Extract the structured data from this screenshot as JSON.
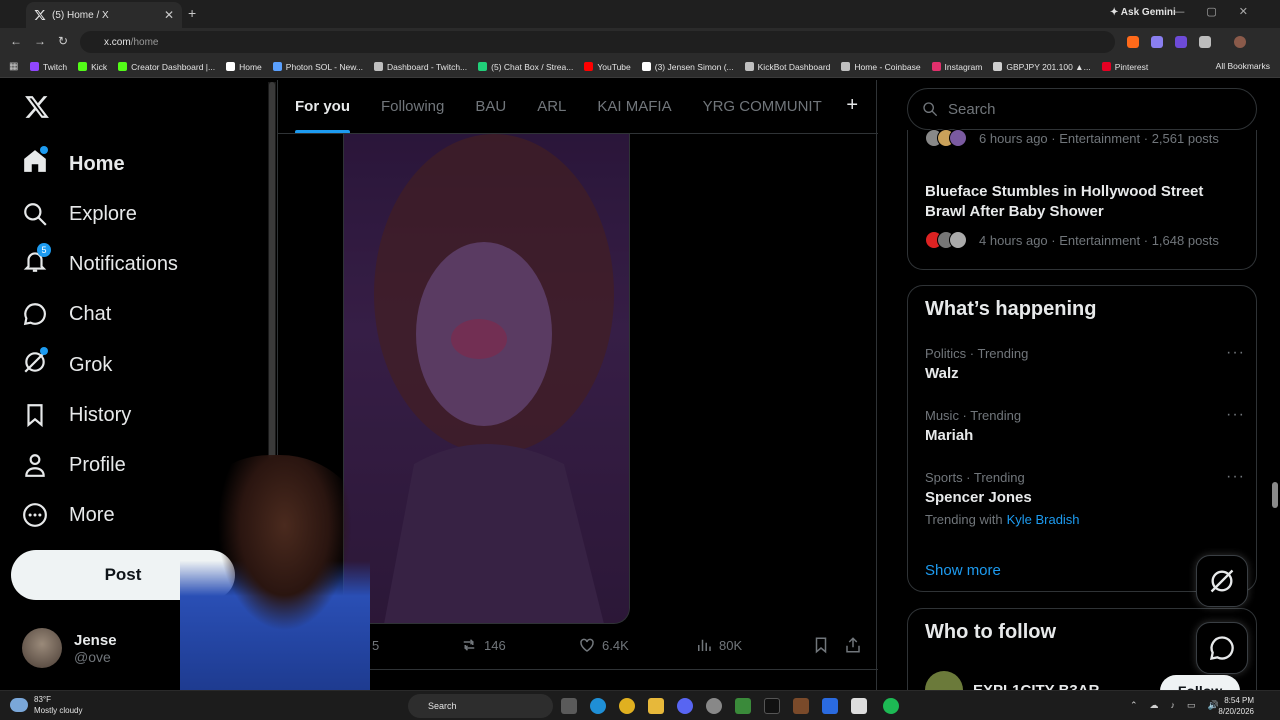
{
  "browser": {
    "tab_title": "(5) Home / X",
    "url_host": "x.com",
    "url_path": "/home",
    "ask_gemini": "Ask Gemini",
    "all_bookmarks": "All Bookmarks",
    "bookmarks": [
      {
        "label": "Twitch",
        "color": "#9146ff"
      },
      {
        "label": "Kick",
        "color": "#53fc18"
      },
      {
        "label": "Creator Dashboard |...",
        "color": "#53fc18"
      },
      {
        "label": "Home",
        "color": "#ffffff"
      },
      {
        "label": "Photon SOL - New...",
        "color": "#5aa0ff"
      },
      {
        "label": "Dashboard - Twitch...",
        "color": "#bfbfbf"
      },
      {
        "label": "(5) Chat Box / Strea...",
        "color": "#21d07a"
      },
      {
        "label": "YouTube",
        "color": "#ff0000"
      },
      {
        "label": "(3) Jensen Simon (...",
        "color": "#ffffff"
      },
      {
        "label": "KickBot Dashboard",
        "color": "#bfbfbf"
      },
      {
        "label": "Home - Coinbase",
        "color": "#bfbfbf"
      },
      {
        "label": "Instagram",
        "color": "#e1306c"
      },
      {
        "label": "GBPJPY 201.100 ▲...",
        "color": "#cfcfcf"
      },
      {
        "label": "Pinterest",
        "color": "#e60023"
      }
    ]
  },
  "nav": {
    "home": "Home",
    "explore": "Explore",
    "notifications": "Notifications",
    "notifications_badge": "5",
    "chat": "Chat",
    "grok": "Grok",
    "history": "History",
    "profile": "Profile",
    "more": "More",
    "post": "Post"
  },
  "account": {
    "name": "Jense",
    "handle": "@ove"
  },
  "feed": {
    "tabs": [
      "For you",
      "Following",
      "BAU",
      "ARL",
      "KAI MAFIA",
      "YRG COMMUNIT"
    ],
    "actions": {
      "replies": "5",
      "reposts": "146",
      "likes": "6.4K",
      "views": "80K"
    }
  },
  "right": {
    "search_placeholder": "Search",
    "story1_meta": "6 hours ago · Entertainment · 2,561 posts",
    "story2_title": "Blueface Stumbles in Hollywood Street Brawl After Baby Shower",
    "story2_meta": "4 hours ago · Entertainment · 1,648 posts",
    "whats_happening": "What’s happening",
    "trends": [
      {
        "context": "Politics · Trending",
        "name": "Walz"
      },
      {
        "context": "Music · Trending",
        "name": "Mariah"
      },
      {
        "context": "Sports · Trending",
        "name": "Spencer Jones",
        "with_label": "Trending with",
        "with_name": "Kyle Bradish"
      }
    ],
    "show_more": "Show more",
    "who_to_follow": "Who to follow",
    "suggestion_name": "EXPL1CITY B3AR",
    "follow": "Follow"
  },
  "taskbar": {
    "temp": "83°F",
    "weather": "Mostly cloudy",
    "search": "Search",
    "time": "8:54 PM",
    "date": "8/20/2026"
  },
  "colors": {
    "accent": "#1d9bf0",
    "bg": "#000000",
    "border": "#2f3336",
    "muted": "#71767b"
  }
}
